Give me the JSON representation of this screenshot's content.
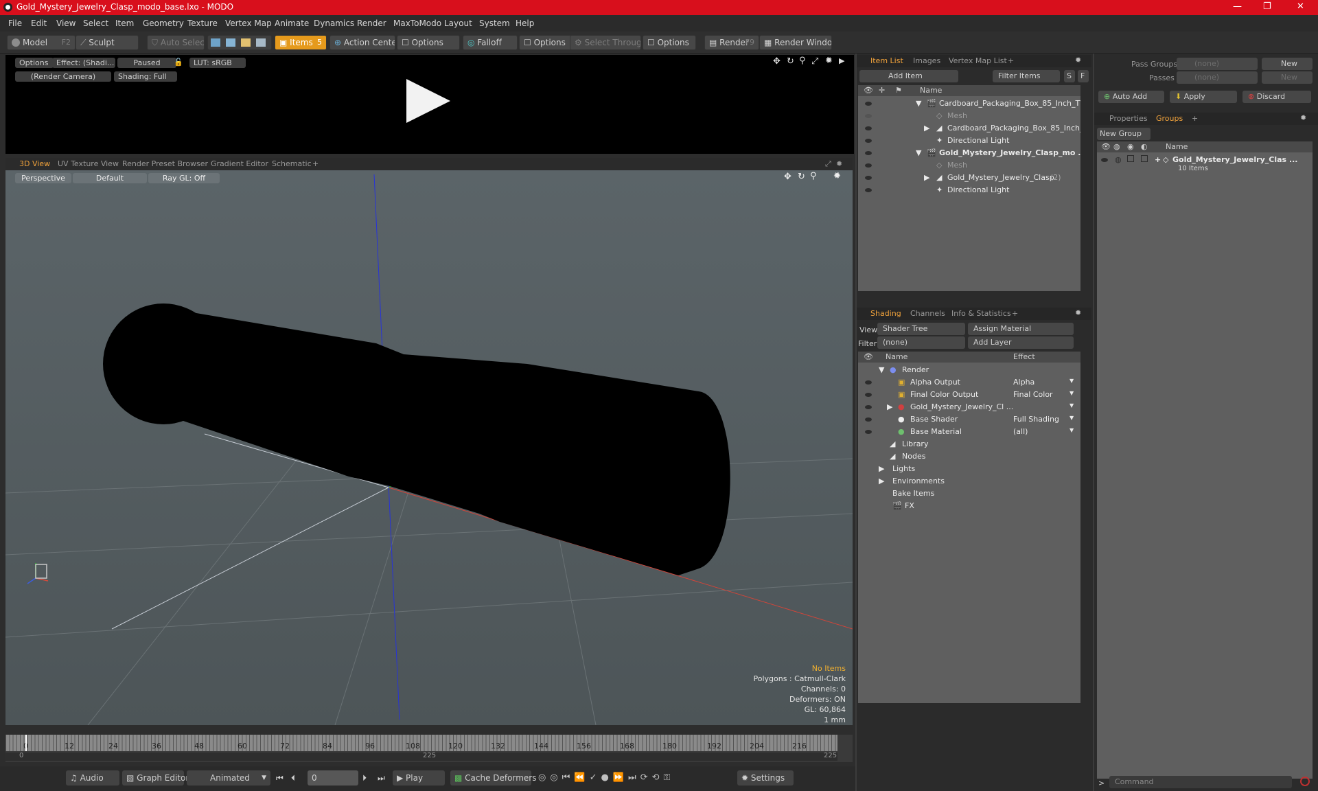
{
  "window": {
    "title": "Gold_Mystery_Jewelry_Clasp_modo_base.lxo - MODO",
    "minimize": "—",
    "maximize": "❐",
    "close": "✕"
  },
  "menu": [
    "File",
    "Edit",
    "View",
    "Select",
    "Item",
    "Geometry",
    "Texture",
    "Vertex Map",
    "Animate",
    "Dynamics",
    "Render",
    "MaxToModo",
    "Layout",
    "System",
    "Help"
  ],
  "toolbar": {
    "model": "Model",
    "model_key": "F2",
    "sculpt": "Sculpt",
    "auto_select": "Auto Select",
    "items": "Items",
    "items_key": "5",
    "action_center": "Action Center",
    "options1": "Options",
    "falloff": "Falloff",
    "options2": "Options",
    "select_through": "Select Through",
    "options3": "Options",
    "render": "Render",
    "render_key": "F9",
    "render_window": "Render Window"
  },
  "preview": {
    "options": "Options",
    "effect": "Effect: (Shadi...",
    "paused": "Paused",
    "lut": "LUT: sRGB",
    "camera": "(Render Camera)",
    "shading": "Shading: Full"
  },
  "view_tabs": [
    "3D View",
    "UV Texture View",
    "Render Preset Browser",
    "Gradient Editor",
    "Schematic",
    "+"
  ],
  "viewport": {
    "perspective": "Perspective",
    "default": "Default",
    "raygl": "Ray GL: Off"
  },
  "viewport_info": {
    "no_items": "No Items",
    "polygons": "Polygons : Catmull-Clark",
    "channels": "Channels: 0",
    "deformers": "Deformers: ON",
    "gl": "GL: 60,864",
    "scale": "1 mm"
  },
  "timeline": {
    "ticks": [
      "0",
      "12",
      "24",
      "36",
      "48",
      "60",
      "72",
      "84",
      "96",
      "108",
      "120",
      "132",
      "144",
      "156",
      "168",
      "180",
      "192",
      "204",
      "216"
    ],
    "start": "0",
    "mid": "225",
    "end": "225"
  },
  "bottom": {
    "audio": "Audio",
    "graph_editor": "Graph Editor",
    "animated": "Animated",
    "frame": "0",
    "play": "Play",
    "cache": "Cache Deformers",
    "settings": "Settings"
  },
  "item_tabs": [
    "Item List",
    "Images",
    "Vertex Map List",
    "+"
  ],
  "item_list": {
    "add_item": "Add Item",
    "filter_items": "Filter Items",
    "s": "S",
    "f": "F",
    "name_col": "Name",
    "rows": [
      {
        "label": "Cardboard_Packaging_Box_85_Inch_TV ...",
        "style": "normal"
      },
      {
        "label": "Mesh",
        "style": "dim"
      },
      {
        "label": "Cardboard_Packaging_Box_85_Inch_...",
        "style": "normal"
      },
      {
        "label": "Directional Light",
        "style": "normal"
      },
      {
        "label": "Gold_Mystery_Jewelry_Clasp_mo ...",
        "style": "bold"
      },
      {
        "label": "Mesh",
        "style": "dim"
      },
      {
        "label": "Gold_Mystery_Jewelry_Clasp",
        "suffix": "(2)",
        "style": "normal"
      },
      {
        "label": "Directional Light",
        "style": "normal"
      }
    ]
  },
  "shading_tabs": [
    "Shading",
    "Channels",
    "Info & Statistics",
    "+"
  ],
  "shading": {
    "view_label": "View",
    "view_value": "Shader Tree",
    "assign_material": "Assign Material",
    "filter_label": "Filter",
    "filter_value": "(none)",
    "add_layer": "Add Layer",
    "name_col": "Name",
    "effect_col": "Effect",
    "rows": [
      {
        "label": "Render",
        "effect": ""
      },
      {
        "label": "Alpha Output",
        "effect": "Alpha"
      },
      {
        "label": "Final Color Output",
        "effect": "Final Color"
      },
      {
        "label": "Gold_Mystery_Jewelry_Cl ...",
        "effect": ""
      },
      {
        "label": "Base Shader",
        "effect": "Full Shading"
      },
      {
        "label": "Base Material",
        "effect": "(all)"
      },
      {
        "label": "Library",
        "effect": ""
      },
      {
        "label": "Nodes",
        "effect": ""
      },
      {
        "label": "Lights",
        "effect": ""
      },
      {
        "label": "Environments",
        "effect": ""
      },
      {
        "label": "Bake Items",
        "effect": ""
      },
      {
        "label": "FX",
        "effect": ""
      }
    ]
  },
  "groups_panel": {
    "pass_groups": "Pass Groups",
    "pass_groups_value": "(none)",
    "new": "New",
    "passes": "Passes",
    "passes_value": "(none)",
    "new2": "New",
    "auto_add": "Auto Add",
    "apply": "Apply",
    "discard": "Discard",
    "tabs": [
      "Properties",
      "Groups",
      "+"
    ],
    "new_group": "New Group",
    "name_col": "Name",
    "group_name": "Gold_Mystery_Jewelry_Clas ...",
    "group_count": "10 Items",
    "command": "Command"
  }
}
